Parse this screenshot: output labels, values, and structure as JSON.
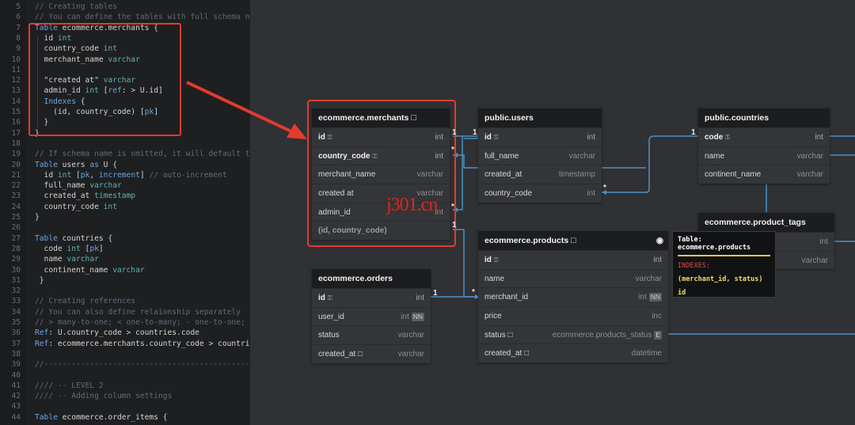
{
  "editor": {
    "lines": [
      {
        "n": "5",
        "parts": [
          [
            "cm",
            "// Creating tables"
          ]
        ]
      },
      {
        "n": "6",
        "parts": [
          [
            "cm",
            "// You can define the tables with full schema names"
          ]
        ]
      },
      {
        "n": "7",
        "parts": [
          [
            "kw",
            "Table "
          ],
          [
            "tx",
            "ecommerce.merchants {"
          ]
        ]
      },
      {
        "n": "8",
        "parts": [
          [
            "tx",
            "  id "
          ],
          [
            "ty",
            "int"
          ]
        ]
      },
      {
        "n": "9",
        "parts": [
          [
            "tx",
            "  country_code "
          ],
          [
            "ty",
            "int"
          ]
        ]
      },
      {
        "n": "10",
        "parts": [
          [
            "tx",
            "  merchant_name "
          ],
          [
            "ty",
            "varchar"
          ]
        ]
      },
      {
        "n": "11",
        "parts": []
      },
      {
        "n": "12",
        "parts": [
          [
            "st",
            "  \"created at\" "
          ],
          [
            "ty",
            "varchar"
          ]
        ]
      },
      {
        "n": "13",
        "parts": [
          [
            "tx",
            "  admin_id "
          ],
          [
            "ty",
            "int "
          ],
          [
            "tx",
            "["
          ],
          [
            "kw",
            "ref"
          ],
          [
            "tx",
            ": > U.id]"
          ]
        ]
      },
      {
        "n": "14",
        "parts": [
          [
            "kw",
            "  Indexes "
          ],
          [
            "tx",
            "{"
          ]
        ]
      },
      {
        "n": "15",
        "parts": [
          [
            "tx",
            "    (id, country_code) ["
          ],
          [
            "kw",
            "pk"
          ],
          [
            "tx",
            "]"
          ]
        ]
      },
      {
        "n": "16",
        "parts": [
          [
            "tx",
            "  }"
          ]
        ]
      },
      {
        "n": "17",
        "parts": [
          [
            "tx",
            "}"
          ]
        ]
      },
      {
        "n": "18",
        "parts": []
      },
      {
        "n": "19",
        "parts": [
          [
            "cm",
            "// If schema name is omitted, it will default to \"p"
          ]
        ]
      },
      {
        "n": "20",
        "parts": [
          [
            "kw",
            "Table "
          ],
          [
            "tx",
            "users "
          ],
          [
            "kw",
            "as "
          ],
          [
            "tx",
            "U {"
          ]
        ]
      },
      {
        "n": "21",
        "parts": [
          [
            "tx",
            "  id "
          ],
          [
            "ty",
            "int "
          ],
          [
            "tx",
            "["
          ],
          [
            "kw",
            "pk"
          ],
          [
            "tx",
            ", "
          ],
          [
            "kw",
            "increment"
          ],
          [
            "tx",
            "] "
          ],
          [
            "cm",
            "// auto-increment"
          ]
        ]
      },
      {
        "n": "22",
        "parts": [
          [
            "tx",
            "  full_name "
          ],
          [
            "ty",
            "varchar"
          ]
        ]
      },
      {
        "n": "23",
        "parts": [
          [
            "tx",
            "  created_at "
          ],
          [
            "ty",
            "timestamp"
          ]
        ]
      },
      {
        "n": "24",
        "parts": [
          [
            "tx",
            "  country_code "
          ],
          [
            "ty",
            "int"
          ]
        ]
      },
      {
        "n": "25",
        "parts": [
          [
            "tx",
            "}"
          ]
        ]
      },
      {
        "n": "26",
        "parts": []
      },
      {
        "n": "27",
        "parts": [
          [
            "kw",
            "Table "
          ],
          [
            "tx",
            "countries {"
          ]
        ]
      },
      {
        "n": "28",
        "parts": [
          [
            "tx",
            "  code "
          ],
          [
            "ty",
            "int "
          ],
          [
            "tx",
            "["
          ],
          [
            "kw",
            "pk"
          ],
          [
            "tx",
            "]"
          ]
        ]
      },
      {
        "n": "29",
        "parts": [
          [
            "tx",
            "  name "
          ],
          [
            "ty",
            "varchar"
          ]
        ]
      },
      {
        "n": "30",
        "parts": [
          [
            "tx",
            "  continent_name "
          ],
          [
            "ty",
            "varchar"
          ]
        ]
      },
      {
        "n": "31",
        "parts": [
          [
            "tx",
            " }"
          ]
        ]
      },
      {
        "n": "32",
        "parts": []
      },
      {
        "n": "33",
        "parts": [
          [
            "cm",
            "// Creating references"
          ]
        ]
      },
      {
        "n": "34",
        "parts": [
          [
            "cm",
            "// You can also define relaionship separately"
          ]
        ]
      },
      {
        "n": "35",
        "parts": [
          [
            "cm",
            "// > many-to-one; < one-to-many; - one-to-one; <> m"
          ]
        ]
      },
      {
        "n": "36",
        "parts": [
          [
            "kw",
            "Ref"
          ],
          [
            "tx",
            ": U.country_code > countries.code"
          ]
        ]
      },
      {
        "n": "37",
        "parts": [
          [
            "kw",
            "Ref"
          ],
          [
            "tx",
            ": ecommerce.merchants.country_code > countries.c"
          ]
        ]
      },
      {
        "n": "38",
        "parts": []
      },
      {
        "n": "39",
        "parts": [
          [
            "cm",
            "//----------------------------------------------//"
          ]
        ]
      },
      {
        "n": "40",
        "parts": []
      },
      {
        "n": "41",
        "parts": [
          [
            "cm",
            "//// -- LEVEL 2"
          ]
        ]
      },
      {
        "n": "42",
        "parts": [
          [
            "cm",
            "//// -- Adding column settings"
          ]
        ]
      },
      {
        "n": "43",
        "parts": []
      },
      {
        "n": "44",
        "parts": [
          [
            "kw",
            "Table "
          ],
          [
            "tx",
            "ecommerce.order_items {"
          ]
        ]
      }
    ]
  },
  "diagram": {
    "merchants": {
      "title": "ecommerce.merchants",
      "rows": [
        {
          "name": "id",
          "type": "int"
        },
        {
          "name": "country_code",
          "type": "int"
        },
        {
          "name": "merchant_name",
          "type": "varchar"
        },
        {
          "name": "created at",
          "type": "varchar"
        },
        {
          "name": "admin_id",
          "type": "int"
        }
      ],
      "index_row": "(id, country_code)"
    },
    "users": {
      "title": "public.users",
      "rows": [
        {
          "name": "id",
          "type": "int"
        },
        {
          "name": "full_name",
          "type": "varchar"
        },
        {
          "name": "created_at",
          "type": "timestamp"
        },
        {
          "name": "country_code",
          "type": "int"
        }
      ]
    },
    "countries": {
      "title": "public.countries",
      "rows": [
        {
          "name": "code",
          "type": "int"
        },
        {
          "name": "name",
          "type": "varchar"
        },
        {
          "name": "continent_name",
          "type": "varchar"
        }
      ]
    },
    "product_tags": {
      "title": "ecommerce.product_tags",
      "rows": [
        {
          "name": "",
          "type": "int"
        },
        {
          "name": "",
          "type": "varchar"
        }
      ]
    },
    "products": {
      "title": "ecommerce.products",
      "rows": [
        {
          "name": "id",
          "type": "int",
          "badge": ""
        },
        {
          "name": "name",
          "type": "varchar",
          "badge": ""
        },
        {
          "name": "merchant_id",
          "type": "int",
          "badge": "NN"
        },
        {
          "name": "price",
          "type": "inc",
          "badge": ""
        },
        {
          "name": "status",
          "type": "ecommerce.products_status",
          "badge": "E"
        },
        {
          "name": "created_at",
          "type": "datetime",
          "badge": ""
        }
      ]
    },
    "orders": {
      "title": "ecommerce.orders",
      "rows": [
        {
          "name": "id",
          "type": "int",
          "badge": ""
        },
        {
          "name": "user_id",
          "type": "int",
          "badge": "NN"
        },
        {
          "name": "status",
          "type": "varchar",
          "badge": ""
        },
        {
          "name": "created_at",
          "type": "varchar",
          "badge": ""
        }
      ]
    },
    "tooltip": {
      "title": "Table: ecommerce.products",
      "indexes_label": "INDEXES:",
      "index_fields": "(merchant_id, status)",
      "index_id": "id"
    },
    "cardinality": {
      "one": "1",
      "many": "*"
    },
    "watermark": "j301.cn",
    "colors": {
      "highlight": "#e53b2c",
      "relation": "#4a90c8",
      "tooltip_rule": "#e8c94a"
    }
  }
}
